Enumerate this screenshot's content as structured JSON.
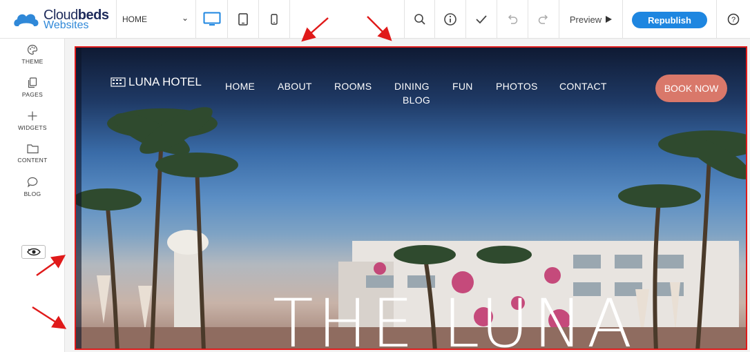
{
  "app": {
    "brand_prefix": "Cloud",
    "brand_bold": "beds",
    "brand_suffix": "Websites"
  },
  "toolbar": {
    "page_select_value": "HOME",
    "preview_label": "Preview",
    "republish_label": "Republish",
    "devices": [
      "desktop-icon",
      "tablet-icon",
      "mobile-icon"
    ],
    "tools": [
      "search-icon",
      "info-icon",
      "check-icon",
      "undo-icon",
      "redo-icon",
      "help-icon"
    ],
    "accent_color": "#1e86e0"
  },
  "sidebar": {
    "items": [
      {
        "label": "THEME",
        "icon": "palette-icon"
      },
      {
        "label": "PAGES",
        "icon": "pages-icon"
      },
      {
        "label": "WIDGETS",
        "icon": "plus-icon"
      },
      {
        "label": "CONTENT",
        "icon": "folder-icon"
      },
      {
        "label": "BLOG",
        "icon": "chat-icon"
      }
    ],
    "toggle_icon": "eye-icon"
  },
  "site": {
    "hotel_name": "LUNA HOTEL",
    "nav": [
      "HOME",
      "ABOUT",
      "ROOMS",
      "DINING",
      "FUN",
      "PHOTOS",
      "CONTACT",
      "BLOG"
    ],
    "book_label": "BOOK NOW",
    "book_color": "#d9786a",
    "hero_title": "THE LUNA"
  },
  "annotations": {
    "highlight_color": "#e01a1a",
    "arrow_count": 4
  }
}
